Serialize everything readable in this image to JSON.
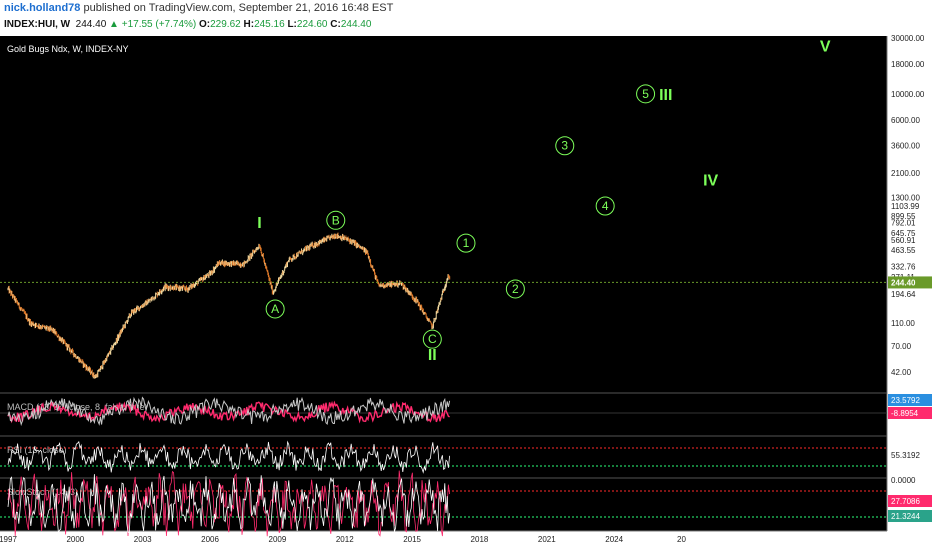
{
  "header": {
    "author": "nick.holland78",
    "published": "published on TradingView.com, September 21, 2016 16:48 EST",
    "symbol": "INDEX:HUI, W",
    "price": "244.40",
    "change": "+17.55 (+7.74%)",
    "open_label": "O:",
    "open": "229.62",
    "high_label": "H:",
    "high": "245.16",
    "low_label": "L:",
    "low": "224.60",
    "close_label": "C:",
    "close": "244.40"
  },
  "colors": {
    "background": "#000000",
    "wave_labels": "#7dff5a",
    "current_price_line": "#6a9a2a",
    "macd_line": "#c8c8c8",
    "macd_signal": "#ff2a6d",
    "rsi_line": "#ffffff",
    "stoch_k": "#ff2a6d",
    "stoch_d": "#ffffff",
    "band_upper": "#ff2a2a",
    "band_lower": "#2aff7a"
  },
  "chart_data": [
    {
      "type": "candlestick",
      "title": "Gold Bugs Ndx, W, INDEX-NY",
      "scale": "log",
      "x_ticks": [
        "1997",
        "2000",
        "2003",
        "2006",
        "2009",
        "2012",
        "2015",
        "2018",
        "2021",
        "2024",
        "20"
      ],
      "y_ticks": [
        "30000.00",
        "18000.00",
        "10000.00",
        "6000.00",
        "3600.00",
        "2100.00",
        "1300.00",
        "1103.99",
        "899.55",
        "792.01",
        "645.75",
        "560.91",
        "463.55",
        "332.76",
        "271.11",
        "244.40",
        "194.64",
        "110.00",
        "70.00",
        "42.00"
      ],
      "current_price": "244.40",
      "price_path": [
        {
          "x": 1997.0,
          "y": 215
        },
        {
          "x": 1998.0,
          "y": 110
        },
        {
          "x": 1999.0,
          "y": 95
        },
        {
          "x": 2000.0,
          "y": 58
        },
        {
          "x": 2000.9,
          "y": 38
        },
        {
          "x": 2001.5,
          "y": 60
        },
        {
          "x": 2002.5,
          "y": 135
        },
        {
          "x": 2003.3,
          "y": 170
        },
        {
          "x": 2004.0,
          "y": 225
        },
        {
          "x": 2005.0,
          "y": 215
        },
        {
          "x": 2006.0,
          "y": 290
        },
        {
          "x": 2006.4,
          "y": 360
        },
        {
          "x": 2007.5,
          "y": 350
        },
        {
          "x": 2008.2,
          "y": 510
        },
        {
          "x": 2008.8,
          "y": 200
        },
        {
          "x": 2009.5,
          "y": 380
        },
        {
          "x": 2010.5,
          "y": 500
        },
        {
          "x": 2011.6,
          "y": 620
        },
        {
          "x": 2012.3,
          "y": 550
        },
        {
          "x": 2013.0,
          "y": 440
        },
        {
          "x": 2013.5,
          "y": 230
        },
        {
          "x": 2014.5,
          "y": 240
        },
        {
          "x": 2015.2,
          "y": 170
        },
        {
          "x": 2015.9,
          "y": 102
        },
        {
          "x": 2016.6,
          "y": 280
        },
        {
          "x": 2016.7,
          "y": 244.4
        }
      ],
      "annotations": [
        {
          "text": "I",
          "x": 2008.2,
          "y": 800,
          "style": "roman"
        },
        {
          "text": "A",
          "x": 2008.9,
          "y": 145,
          "style": "circle"
        },
        {
          "text": "B",
          "x": 2011.6,
          "y": 830,
          "style": "circle"
        },
        {
          "text": "C",
          "x": 2015.9,
          "y": 80,
          "style": "circle"
        },
        {
          "text": "II",
          "x": 2015.9,
          "y": 60,
          "style": "roman"
        },
        {
          "text": "1",
          "x": 2017.4,
          "y": 530,
          "style": "circle"
        },
        {
          "text": "2",
          "x": 2019.6,
          "y": 215,
          "style": "circle"
        },
        {
          "text": "3",
          "x": 2021.8,
          "y": 3600,
          "style": "circle"
        },
        {
          "text": "4",
          "x": 2023.6,
          "y": 1100,
          "style": "circle"
        },
        {
          "text": "5",
          "x": 2025.4,
          "y": 10000,
          "style": "circle"
        },
        {
          "text": "III",
          "x": 2026.3,
          "y": 10000,
          "style": "roman"
        },
        {
          "text": "IV",
          "x": 2028.3,
          "y": 1850,
          "style": "roman"
        },
        {
          "text": "V",
          "x": 2033.4,
          "y": 26000,
          "style": "roman"
        }
      ]
    },
    {
      "type": "line",
      "title": "MACD (13, 34, close, 8, false, true)",
      "values": [
        "23.5792",
        "-8.8954"
      ]
    },
    {
      "type": "line",
      "title": "RSI (13, close)",
      "values": [
        "55.3192"
      ]
    },
    {
      "type": "line",
      "title": "SlowStoch (14, 3)",
      "values": [
        "0.0000",
        "27.7086",
        "21.3244"
      ]
    }
  ]
}
